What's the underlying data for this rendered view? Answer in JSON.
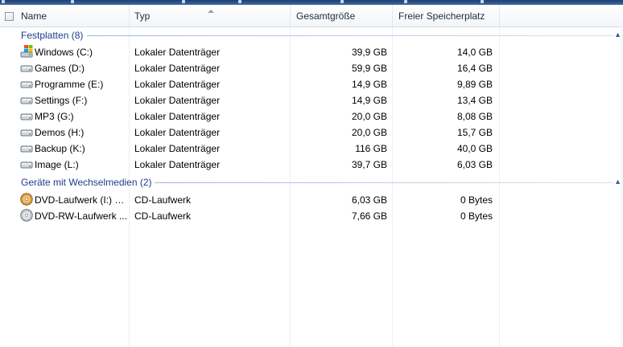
{
  "columns": {
    "name": "Name",
    "type": "Typ",
    "total": "Gesamtgröße",
    "free": "Freier Speicherplatz"
  },
  "groups": [
    {
      "title": "Festplatten (8)",
      "items": [
        {
          "icon": "windows-drive-icon",
          "name": "Windows (C:)",
          "type": "Lokaler Datenträger",
          "total": "39,9 GB",
          "free": "14,0 GB"
        },
        {
          "icon": "hard-drive-icon",
          "name": "Games (D:)",
          "type": "Lokaler Datenträger",
          "total": "59,9 GB",
          "free": "16,4 GB"
        },
        {
          "icon": "hard-drive-icon",
          "name": "Programme (E:)",
          "type": "Lokaler Datenträger",
          "total": "14,9 GB",
          "free": "9,89 GB"
        },
        {
          "icon": "hard-drive-icon",
          "name": "Settings (F:)",
          "type": "Lokaler Datenträger",
          "total": "14,9 GB",
          "free": "13,4 GB"
        },
        {
          "icon": "hard-drive-icon",
          "name": "MP3 (G:)",
          "type": "Lokaler Datenträger",
          "total": "20,0 GB",
          "free": "8,08 GB"
        },
        {
          "icon": "hard-drive-icon",
          "name": "Demos (H:)",
          "type": "Lokaler Datenträger",
          "total": "20,0 GB",
          "free": "15,7 GB"
        },
        {
          "icon": "hard-drive-icon",
          "name": "Backup (K:)",
          "type": "Lokaler Datenträger",
          "total": "116 GB",
          "free": "40,0 GB"
        },
        {
          "icon": "hard-drive-icon",
          "name": "Image (L:)",
          "type": "Lokaler Datenträger",
          "total": "39,7 GB",
          "free": "6,03 GB"
        }
      ]
    },
    {
      "title": "Geräte mit Wechselmedien (2)",
      "items": [
        {
          "icon": "dvd-disc-icon",
          "name": "DVD-Laufwerk (I:) B...",
          "type": "CD-Laufwerk",
          "total": "6,03 GB",
          "free": "0 Bytes"
        },
        {
          "icon": "dvd-rw-disc-icon",
          "name": "DVD-RW-Laufwerk ...",
          "type": "CD-Laufwerk",
          "total": "7,66 GB",
          "free": "0 Bytes"
        }
      ]
    }
  ],
  "colors": {
    "group_title": "#1e3c8c",
    "title_bar": "#2b5088"
  }
}
